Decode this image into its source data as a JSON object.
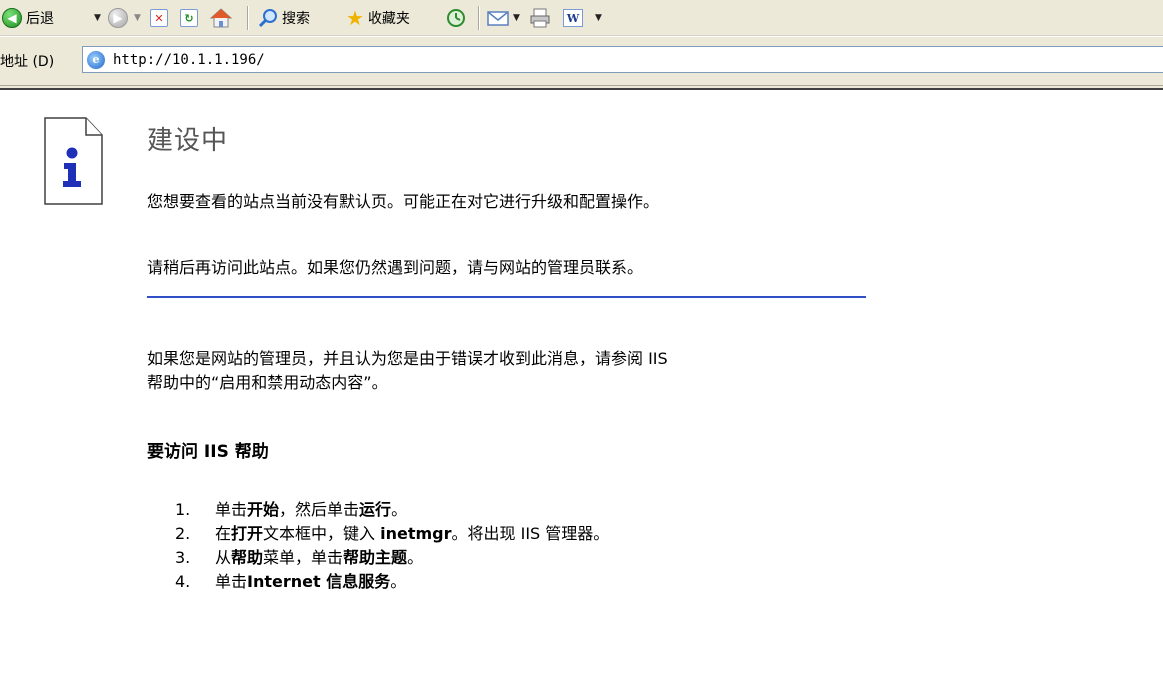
{
  "toolbar": {
    "back_label": "后退",
    "search_label": "搜索",
    "favorites_label": "收藏夹",
    "history_icon": "history-icon",
    "mail_icon": "mail-icon",
    "print_icon": "print-icon",
    "word_icon": "word-icon"
  },
  "address_bar": {
    "label": "地址 (D)",
    "url": "http://10.1.1.196/"
  },
  "page": {
    "title": "建设中",
    "paragraph_1": "您想要查看的站点当前没有默认页。可能正在对它进行升级和配置操作。",
    "paragraph_2": "请稍后再访问此站点。如果您仍然遇到问题，请与网站的管理员联系。",
    "paragraph_3_line1": "如果您是网站的管理员，并且认为您是由于错误才收到此消息，请参阅 IIS",
    "paragraph_3_line2": "帮助中的“启用和禁用动态内容”。",
    "subheading": "要访问 IIS 帮助",
    "steps": [
      {
        "num": "1.",
        "pre": "单击",
        "b1": "开始",
        "mid": "，然后单击",
        "b2": "运行",
        "post": "。"
      },
      {
        "num": "2.",
        "pre": "在",
        "b1": "打开",
        "mid": "文本框中，键入 ",
        "b2": "inetmgr",
        "post": "。将出现 IIS 管理器。"
      },
      {
        "num": "3.",
        "pre": "从",
        "b1": "帮助",
        "mid": "菜单，单击",
        "b2": "帮助主题",
        "post": "。"
      },
      {
        "num": "4.",
        "pre": "单击",
        "b1": "Internet 信息服务",
        "mid": "",
        "b2": "",
        "post": "。"
      }
    ]
  },
  "colors": {
    "chrome_bg": "#ece9d8",
    "rule_blue": "#3050c8",
    "icon_blue": "#1e2fb8"
  }
}
